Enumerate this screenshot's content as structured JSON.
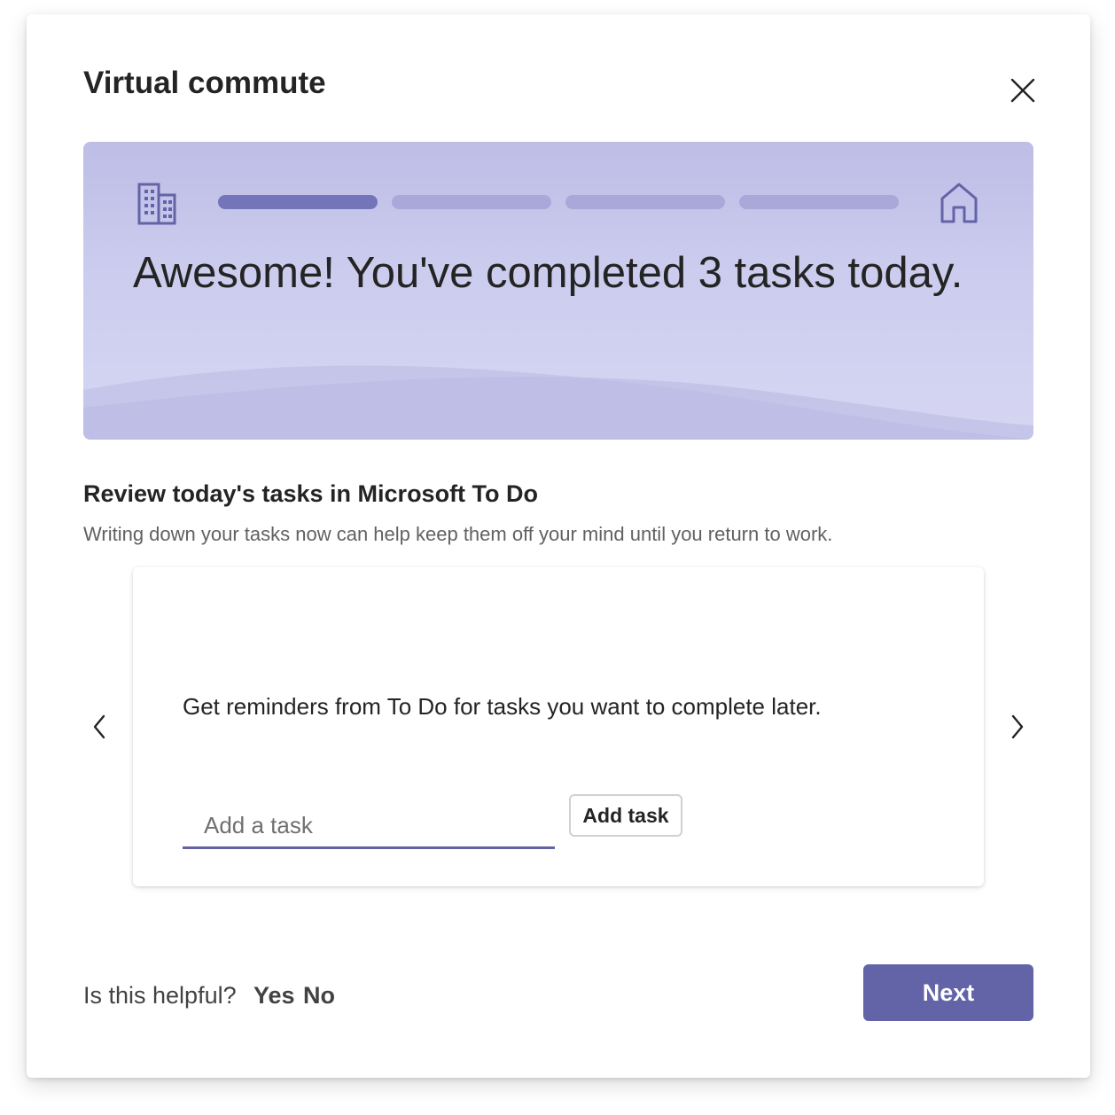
{
  "dialog": {
    "title": "Virtual commute",
    "close_icon": "close-icon"
  },
  "banner": {
    "start_icon": "building-icon",
    "end_icon": "home-icon",
    "progress": {
      "total_steps": 4,
      "current_step": 1
    },
    "message": "Awesome! You've completed 3 tasks today."
  },
  "section": {
    "heading": "Review today's tasks in Microsoft To Do",
    "subtext": "Writing down your tasks now can help keep them off your mind until you return to work."
  },
  "card": {
    "text": "Get reminders from To Do for tasks you want to complete later.",
    "input_placeholder": "Add a task",
    "input_value": "",
    "add_button_label": "Add task",
    "prev_icon": "chevron-left-icon",
    "next_icon": "chevron-right-icon"
  },
  "footer": {
    "question": "Is this helpful?",
    "yes_label": "Yes",
    "no_label": "No",
    "next_label": "Next"
  },
  "colors": {
    "accent": "#6264a7",
    "banner_background": "#cbcbee",
    "progress_active": "#7474b8",
    "progress_inactive": "#a9a9d9"
  }
}
